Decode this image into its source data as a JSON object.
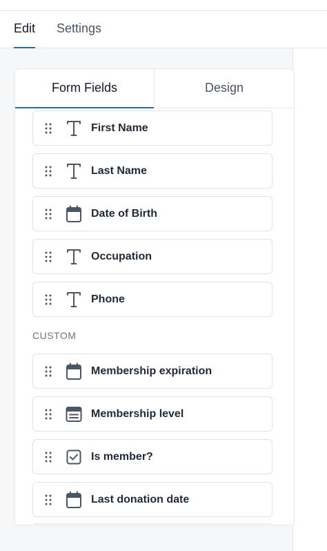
{
  "top_tabs": [
    {
      "label": "Edit",
      "active": true
    },
    {
      "label": "Settings",
      "active": false
    }
  ],
  "panel_tabs": [
    {
      "label": "Form Fields",
      "active": true
    },
    {
      "label": "Design",
      "active": false
    }
  ],
  "fields": [
    {
      "label": "First Name",
      "icon": "text-icon"
    },
    {
      "label": "Last Name",
      "icon": "text-icon"
    },
    {
      "label": "Date of Birth",
      "icon": "calendar-icon"
    },
    {
      "label": "Occupation",
      "icon": "text-icon"
    },
    {
      "label": "Phone",
      "icon": "text-icon"
    }
  ],
  "custom_section": {
    "label": "CUSTOM",
    "fields": [
      {
        "label": "Membership expiration",
        "icon": "calendar-icon"
      },
      {
        "label": "Membership level",
        "icon": "dropdown-list-icon"
      },
      {
        "label": "Is member?",
        "icon": "checkbox-icon"
      },
      {
        "label": "Last donation date",
        "icon": "calendar-icon"
      }
    ]
  },
  "colors": {
    "accent": "#2b6a99",
    "icon": "#4b5563",
    "border": "#dfe2e6",
    "background": "#f6f7f9"
  }
}
